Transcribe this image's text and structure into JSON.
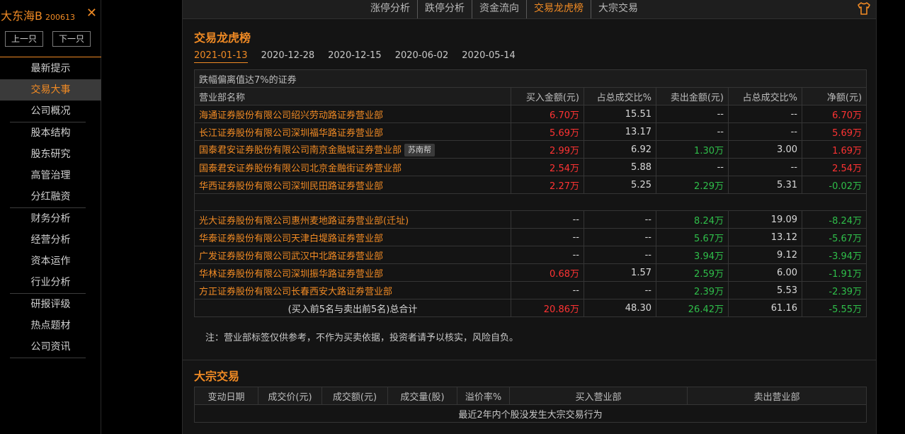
{
  "sidebar": {
    "stock_name": "大东海B",
    "stock_code": "200613",
    "close_symbol": "✕",
    "prev_label": "上一只",
    "next_label": "下一只",
    "menu_groups": [
      [
        "最新提示",
        "交易大事",
        "公司概况"
      ],
      [
        "股本结构",
        "股东研究",
        "高管治理",
        "分红融资"
      ],
      [
        "财务分析",
        "经营分析",
        "资本运作",
        "行业分析"
      ],
      [
        "研报评级",
        "热点题材",
        "公司资讯"
      ]
    ],
    "active_item": "交易大事"
  },
  "tabs": {
    "items": [
      "涨停分析",
      "跌停分析",
      "资金流向",
      "交易龙虎榜",
      "大宗交易"
    ],
    "active": "交易龙虎榜",
    "theme_icon": "shirt-icon"
  },
  "lhb": {
    "title": "交易龙虎榜",
    "dates": [
      "2021-01-13",
      "2020-12-28",
      "2020-12-15",
      "2020-06-02",
      "2020-05-14"
    ],
    "active_date": "2021-01-13",
    "caption": "跌幅偏离值达7%的证券",
    "headers": [
      "营业部名称",
      "买入金额(元)",
      "占总成交比%",
      "卖出金额(元)",
      "占总成交比%",
      "净额(元)"
    ],
    "buy_rows": [
      {
        "branch": "海通证券股份有限公司绍兴劳动路证券营业部",
        "tag": "",
        "buy": "6.70万",
        "buy_pct": "15.51",
        "sell": "--",
        "sell_pct": "--",
        "net": "6.70万",
        "net_color": "red"
      },
      {
        "branch": "长江证券股份有限公司深圳福华路证券营业部",
        "tag": "",
        "buy": "5.69万",
        "buy_pct": "13.17",
        "sell": "--",
        "sell_pct": "--",
        "net": "5.69万",
        "net_color": "red"
      },
      {
        "branch": "国泰君安证券股份有限公司南京金融城证券营业部",
        "tag": "苏南帮",
        "buy": "2.99万",
        "buy_pct": "6.92",
        "sell": "1.30万",
        "sell_pct": "3.00",
        "net": "1.69万",
        "net_color": "red"
      },
      {
        "branch": "国泰君安证券股份有限公司北京金融街证券营业部",
        "tag": "",
        "buy": "2.54万",
        "buy_pct": "5.88",
        "sell": "--",
        "sell_pct": "--",
        "net": "2.54万",
        "net_color": "red"
      },
      {
        "branch": "华西证券股份有限公司深圳民田路证券营业部",
        "tag": "",
        "buy": "2.27万",
        "buy_pct": "5.25",
        "sell": "2.29万",
        "sell_pct": "5.31",
        "net": "-0.02万",
        "net_color": "green"
      }
    ],
    "sell_rows": [
      {
        "branch": "光大证券股份有限公司惠州麦地路证券营业部(迁址)",
        "tag": "",
        "buy": "--",
        "buy_pct": "--",
        "sell": "8.24万",
        "sell_pct": "19.09",
        "net": "-8.24万",
        "net_color": "green"
      },
      {
        "branch": "华泰证券股份有限公司天津白堤路证券营业部",
        "tag": "",
        "buy": "--",
        "buy_pct": "--",
        "sell": "5.67万",
        "sell_pct": "13.12",
        "net": "-5.67万",
        "net_color": "green"
      },
      {
        "branch": "广发证券股份有限公司武汉中北路证券营业部",
        "tag": "",
        "buy": "--",
        "buy_pct": "--",
        "sell": "3.94万",
        "sell_pct": "9.12",
        "net": "-3.94万",
        "net_color": "green"
      },
      {
        "branch": "华林证券股份有限公司深圳振华路证券营业部",
        "tag": "",
        "buy": "0.68万",
        "buy_pct": "1.57",
        "sell": "2.59万",
        "sell_pct": "6.00",
        "net": "-1.91万",
        "net_color": "green"
      },
      {
        "branch": "方正证券股份有限公司长春西安大路证券营业部",
        "tag": "",
        "buy": "--",
        "buy_pct": "--",
        "sell": "2.39万",
        "sell_pct": "5.53",
        "net": "-2.39万",
        "net_color": "green"
      }
    ],
    "total": {
      "label": "(买入前5名与卖出前5名)总合计",
      "buy": "20.86万",
      "buy_pct": "48.30",
      "sell": "26.42万",
      "sell_pct": "61.16",
      "net": "-5.55万"
    },
    "note": "注：营业部标签仅供参考，不作为买卖依据，投资者请予以核实，风险自负。"
  },
  "block_trade": {
    "title": "大宗交易",
    "headers": [
      "变动日期",
      "成交价(元)",
      "成交额(元)",
      "成交量(股)",
      "溢价率%",
      "买入营业部",
      "卖出营业部"
    ],
    "empty_message": "最近2年内个股没发生大宗交易行为"
  },
  "colors": {
    "accent": "#f08a24",
    "up": "#ff3333",
    "down": "#2fbf4a",
    "background": "#141414"
  }
}
